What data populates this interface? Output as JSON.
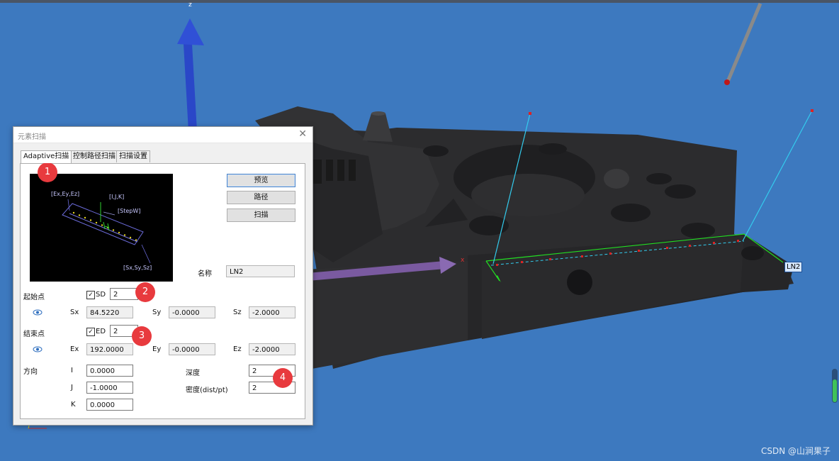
{
  "viewport": {
    "axis_z_label": "z",
    "axis_x_label": "x",
    "tag_label": "LN2",
    "watermark": "CSDN @山涧果子"
  },
  "dialog": {
    "title": "元素扫描",
    "close_glyph": "✕",
    "tabs": [
      "Adaptive扫描",
      "控制路径扫描",
      "扫描设置"
    ],
    "preview": {
      "label_end": "[Ex,Ey,Ez]",
      "label_vec": "[I,J,K]",
      "label_step": "[StepW]",
      "label_start": "[Sx,Sy,Sz]"
    },
    "buttons": {
      "preview": "预览",
      "path": "路径",
      "scan": "扫描"
    },
    "name": {
      "label": "名称",
      "value": "LN2"
    },
    "start": {
      "label": "起始点",
      "check_label": "SD",
      "checked": true,
      "check_value": "2",
      "sx_label": "Sx",
      "sx": "84.5220",
      "sy_label": "Sy",
      "sy": "-0.0000",
      "sz_label": "Sz",
      "sz": "-2.0000"
    },
    "end": {
      "label": "结束点",
      "check_label": "ED",
      "checked": true,
      "check_value": "2",
      "ex_label": "Ex",
      "ex": "192.0000",
      "ey_label": "Ey",
      "ey": "-0.0000",
      "ez_label": "Ez",
      "ez": "-2.0000"
    },
    "direction": {
      "label": "方向",
      "i_label": "I",
      "i": "0.0000",
      "j_label": "J",
      "j": "-1.0000",
      "k_label": "K",
      "k": "0.0000",
      "depth_label": "深度",
      "depth": "2",
      "density_label": "密度(dist/pt)",
      "density": "2"
    },
    "badges": [
      "1",
      "2",
      "3",
      "4"
    ]
  },
  "colors": {
    "background": "#3d79bf",
    "part": "#2a2a2c",
    "scan_line": "#22dd22",
    "probe_vector": "#33ccee",
    "badge": "#e83a3e"
  }
}
